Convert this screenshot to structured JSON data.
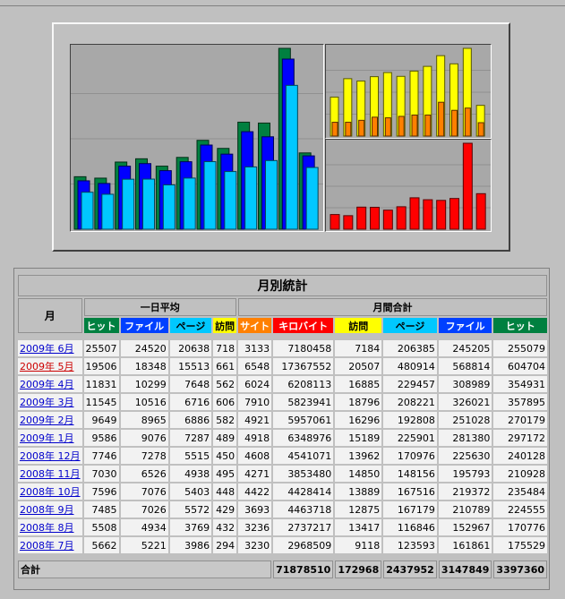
{
  "table": {
    "title": "月別統計",
    "month_header": "月",
    "daily_avg_header": "一日平均",
    "monthly_total_header": "月間合計",
    "daily_cols": [
      {
        "label": "ヒット",
        "color": "#008040",
        "text_color": "#ffffff"
      },
      {
        "label": "ファイル",
        "color": "#0040ff",
        "text_color": "#ffffff"
      },
      {
        "label": "ページ",
        "color": "#00c8ff",
        "text_color": "#000000"
      },
      {
        "label": "訪問",
        "color": "#ffff00",
        "text_color": "#000000"
      }
    ],
    "monthly_cols": [
      {
        "label": "サイト",
        "color": "#ff8000",
        "text_color": "#ffffff"
      },
      {
        "label": "キロバイト",
        "color": "#ff0000",
        "text_color": "#ffffff"
      },
      {
        "label": "訪問",
        "color": "#ffff00",
        "text_color": "#000000"
      },
      {
        "label": "ページ",
        "color": "#00c8ff",
        "text_color": "#000000"
      },
      {
        "label": "ファイル",
        "color": "#0040ff",
        "text_color": "#ffffff"
      },
      {
        "label": "ヒット",
        "color": "#008040",
        "text_color": "#ffffff"
      }
    ],
    "rows": [
      {
        "month": "2009年 6月",
        "current": false,
        "daily": [
          "25507",
          "24520",
          "20638",
          "718"
        ],
        "monthly": [
          "3133",
          "7180458",
          "7184",
          "206385",
          "245205",
          "255079"
        ]
      },
      {
        "month": "2009年 5月",
        "current": true,
        "daily": [
          "19506",
          "18348",
          "15513",
          "661"
        ],
        "monthly": [
          "6548",
          "17367552",
          "20507",
          "480914",
          "568814",
          "604704"
        ]
      },
      {
        "month": "2009年 4月",
        "current": false,
        "daily": [
          "11831",
          "10299",
          "7648",
          "562"
        ],
        "monthly": [
          "6024",
          "6208113",
          "16885",
          "229457",
          "308989",
          "354931"
        ]
      },
      {
        "month": "2009年 3月",
        "current": false,
        "daily": [
          "11545",
          "10516",
          "6716",
          "606"
        ],
        "monthly": [
          "7910",
          "5823941",
          "18796",
          "208221",
          "326021",
          "357895"
        ]
      },
      {
        "month": "2009年 2月",
        "current": false,
        "daily": [
          "9649",
          "8965",
          "6886",
          "582"
        ],
        "monthly": [
          "4921",
          "5957061",
          "16296",
          "192808",
          "251028",
          "270179"
        ]
      },
      {
        "month": "2009年 1月",
        "current": false,
        "daily": [
          "9586",
          "9076",
          "7287",
          "489"
        ],
        "monthly": [
          "4918",
          "6348976",
          "15189",
          "225901",
          "281380",
          "297172"
        ]
      },
      {
        "month": "2008年 12月",
        "current": false,
        "daily": [
          "7746",
          "7278",
          "5515",
          "450"
        ],
        "monthly": [
          "4608",
          "4541071",
          "13962",
          "170976",
          "225630",
          "240128"
        ]
      },
      {
        "month": "2008年 11月",
        "current": false,
        "daily": [
          "7030",
          "6526",
          "4938",
          "495"
        ],
        "monthly": [
          "4271",
          "3853480",
          "14850",
          "148156",
          "195793",
          "210928"
        ]
      },
      {
        "month": "2008年 10月",
        "current": false,
        "daily": [
          "7596",
          "7076",
          "5403",
          "448"
        ],
        "monthly": [
          "4422",
          "4428414",
          "13889",
          "167516",
          "219372",
          "235484"
        ]
      },
      {
        "month": "2008年 9月",
        "current": false,
        "daily": [
          "7485",
          "7026",
          "5572",
          "429"
        ],
        "monthly": [
          "3693",
          "4463718",
          "12875",
          "167179",
          "210789",
          "224555"
        ]
      },
      {
        "month": "2008年 8月",
        "current": false,
        "daily": [
          "5508",
          "4934",
          "3769",
          "432"
        ],
        "monthly": [
          "3236",
          "2737217",
          "13417",
          "116846",
          "152967",
          "170776"
        ]
      },
      {
        "month": "2008年 7月",
        "current": false,
        "daily": [
          "5662",
          "5221",
          "3986",
          "294"
        ],
        "monthly": [
          "3230",
          "2968509",
          "9118",
          "123593",
          "161861",
          "175529"
        ]
      }
    ],
    "total_label": "合計",
    "totals": [
      "71878510",
      "172968",
      "2437952",
      "3147849",
      "3397360"
    ]
  },
  "chart_data": [
    {
      "type": "bar",
      "categories": [
        "2008-07",
        "2008-08",
        "2008-09",
        "2008-10",
        "2008-11",
        "2008-12",
        "2009-01",
        "2009-02",
        "2009-03",
        "2009-04",
        "2009-05",
        "2009-06"
      ],
      "series": [
        {
          "values": [
            175529,
            170776,
            224555,
            235484,
            210928,
            240128,
            297172,
            270179,
            357895,
            354931,
            604704,
            255079
          ],
          "color": "#008040"
        },
        {
          "values": [
            161861,
            152967,
            210789,
            219372,
            195793,
            225630,
            281380,
            251028,
            326021,
            308989,
            568814,
            245205
          ],
          "color": "#0000ff"
        },
        {
          "values": [
            123593,
            116846,
            167179,
            167516,
            148156,
            170976,
            225901,
            192808,
            208221,
            229457,
            480914,
            206385
          ],
          "color": "#00c8ff"
        }
      ],
      "ylim": [
        0,
        604704
      ]
    },
    {
      "type": "bar",
      "categories": [
        "2008-07",
        "2008-08",
        "2008-09",
        "2008-10",
        "2008-11",
        "2008-12",
        "2009-01",
        "2009-02",
        "2009-03",
        "2009-04",
        "2009-05",
        "2009-06"
      ],
      "series": [
        {
          "values": [
            9118,
            13417,
            12875,
            13889,
            14850,
            13962,
            15189,
            16296,
            18796,
            16885,
            20507,
            7184
          ],
          "color": "#ffff00"
        },
        {
          "values": [
            3230,
            3236,
            3693,
            4422,
            4271,
            4608,
            4918,
            4921,
            7910,
            6024,
            6548,
            3133
          ],
          "color": "#ff8000"
        }
      ],
      "ylim": [
        0,
        20507
      ]
    },
    {
      "type": "bar",
      "categories": [
        "2008-07",
        "2008-08",
        "2008-09",
        "2008-10",
        "2008-11",
        "2008-12",
        "2009-01",
        "2009-02",
        "2009-03",
        "2009-04",
        "2009-05",
        "2009-06"
      ],
      "series": [
        {
          "values": [
            2968509,
            2737217,
            4463718,
            4428414,
            3853480,
            4541071,
            6348976,
            5957061,
            5823941,
            6208113,
            17367552,
            7180458
          ],
          "color": "#ff0000"
        }
      ],
      "ylim": [
        0,
        17367552
      ]
    }
  ]
}
